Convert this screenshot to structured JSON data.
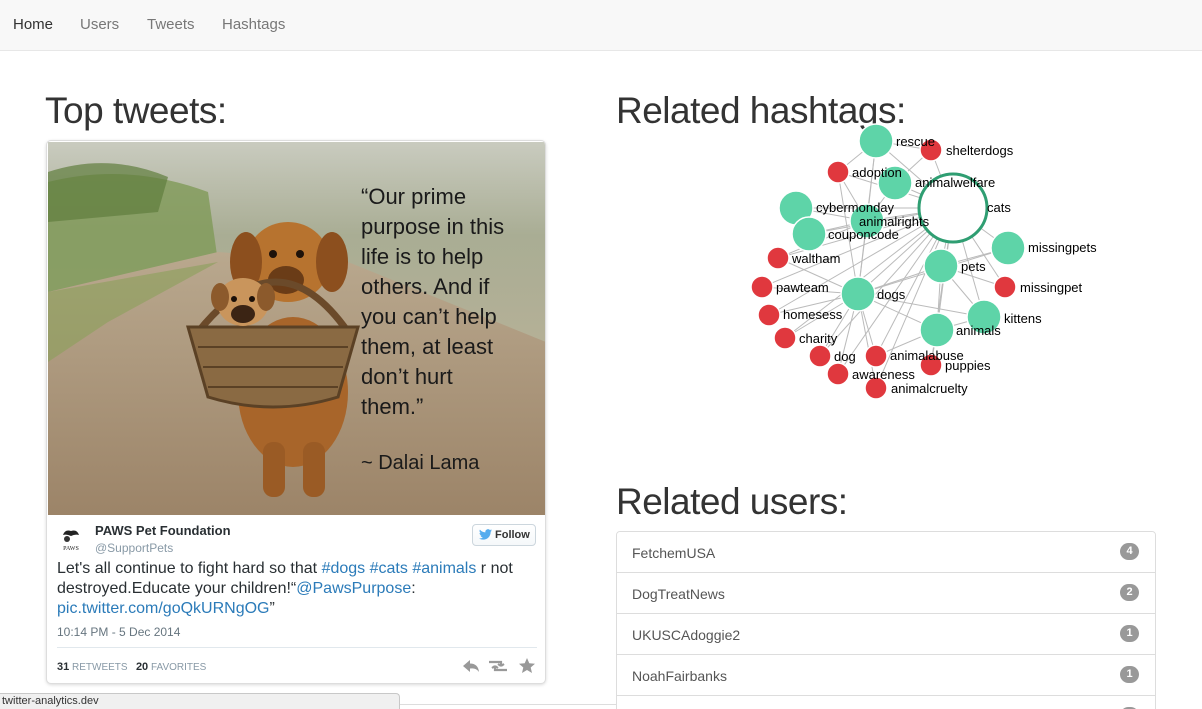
{
  "nav": {
    "items": [
      {
        "label": "Home",
        "active": true
      },
      {
        "label": "Users",
        "active": false
      },
      {
        "label": "Tweets",
        "active": false
      },
      {
        "label": "Hashtags",
        "active": false
      }
    ]
  },
  "top_tweets": {
    "title": "Top tweets:",
    "tweet": {
      "image_quote": {
        "lines": [
          "“Our prime",
          "purpose in this",
          "life is to help",
          "others. And if",
          "you can’t help",
          "them, at least",
          "don’t hurt",
          "them.”"
        ],
        "attribution": "~ Dalai Lama"
      },
      "avatar_text": "PAWS",
      "author_name": "PAWS Pet Foundation",
      "author_handle": "@SupportPets",
      "follow_label": "Follow",
      "text_parts": {
        "t1": "Let's all continue to fight hard so that ",
        "h1": "#dogs",
        "t2": "  ",
        "h2": "#cats",
        "t3": " ",
        "h3": "#animals",
        "t4": " r not destroyed.Educate your children!“",
        "mention": "@PawsPurpose",
        "t5": ": ",
        "link": "pic.twitter.com/goQkURNgOG",
        "t6": "”"
      },
      "timestamp": "10:14 PM - 5 Dec 2014",
      "retweets_count": "31",
      "retweets_label": "RETWEETS",
      "favorites_count": "20",
      "favorites_label": "FAVORITES"
    }
  },
  "related_hashtags": {
    "title": "Related hashtags:",
    "colors": {
      "related": "#5ed4a8",
      "other": "#e0383e",
      "center_stroke": "#2f9e72"
    },
    "nodes": [
      {
        "id": "rescue",
        "label": "rescue",
        "kind": "green"
      },
      {
        "id": "shelterdogs",
        "label": "shelterdogs",
        "kind": "red"
      },
      {
        "id": "adoption",
        "label": "adoption",
        "kind": "red"
      },
      {
        "id": "animalwelfare",
        "label": "animalwelfare",
        "kind": "green"
      },
      {
        "id": "cybermonday",
        "label": "cybermonday",
        "kind": "green"
      },
      {
        "id": "cats",
        "label": "cats",
        "kind": "center"
      },
      {
        "id": "animalrights",
        "label": "animalrights",
        "kind": "green"
      },
      {
        "id": "couponcode",
        "label": "couponcode",
        "kind": "green"
      },
      {
        "id": "missingpets",
        "label": "missingpets",
        "kind": "green"
      },
      {
        "id": "waltham",
        "label": "waltham",
        "kind": "red"
      },
      {
        "id": "pets",
        "label": "pets",
        "kind": "green"
      },
      {
        "id": "pawteam",
        "label": "pawteam",
        "kind": "red"
      },
      {
        "id": "missingpet",
        "label": "missingpet",
        "kind": "red"
      },
      {
        "id": "dogs",
        "label": "dogs",
        "kind": "green"
      },
      {
        "id": "homesess",
        "label": "homesess",
        "kind": "red"
      },
      {
        "id": "kittens",
        "label": "kittens",
        "kind": "green"
      },
      {
        "id": "charity",
        "label": "charity",
        "kind": "red"
      },
      {
        "id": "animals",
        "label": "animals",
        "kind": "green"
      },
      {
        "id": "dog",
        "label": "dog",
        "kind": "red"
      },
      {
        "id": "animalabuse",
        "label": "animalabuse",
        "kind": "red"
      },
      {
        "id": "puppies",
        "label": "puppies",
        "kind": "red"
      },
      {
        "id": "awareness",
        "label": "awareness",
        "kind": "red"
      },
      {
        "id": "animalcruelty",
        "label": "animalcruelty",
        "kind": "red"
      }
    ]
  },
  "related_users": {
    "title": "Related users:",
    "users": [
      {
        "name": "FetchemUSA",
        "count": "4"
      },
      {
        "name": "DogTreatNews",
        "count": "2"
      },
      {
        "name": "UKUSCAdoggie2",
        "count": "1"
      },
      {
        "name": "NoahFairbanks",
        "count": "1"
      },
      {
        "name": "",
        "count": ""
      }
    ]
  },
  "status_bar": {
    "url": "twitter-analytics.dev"
  }
}
